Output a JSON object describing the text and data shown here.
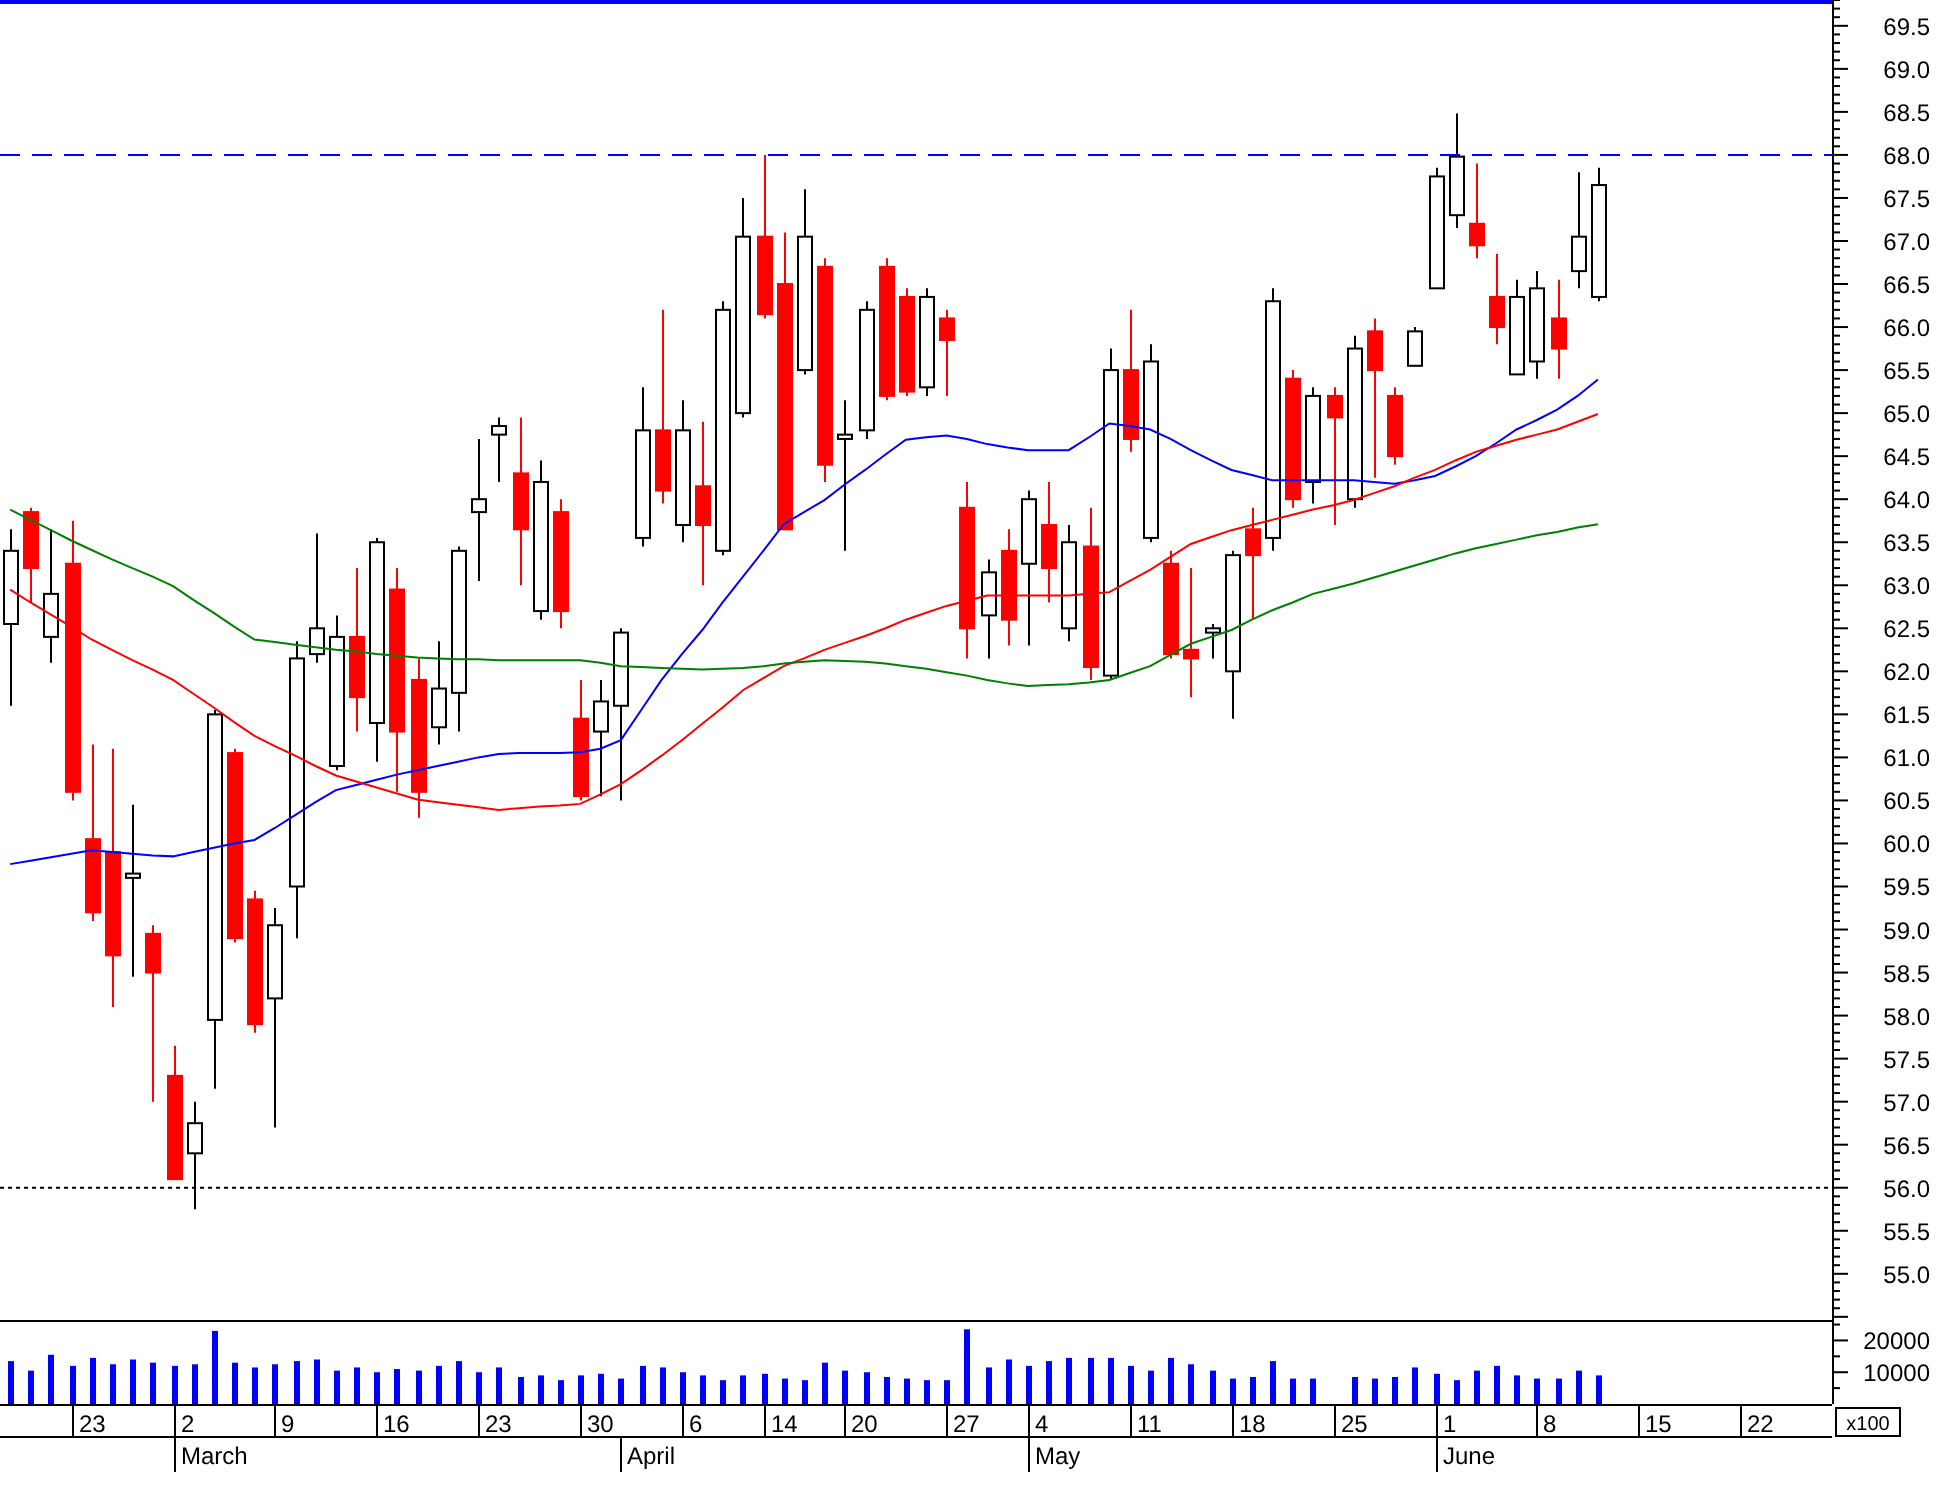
{
  "price_panel": {
    "chart_data": {
      "type": "candlestick",
      "ylim": [
        54.44,
        69.8
      ],
      "categories": [
        null,
        null,
        null,
        null,
        null,
        null,
        null,
        null,
        null,
        null,
        null,
        null,
        null,
        null,
        null,
        null,
        null,
        null,
        null,
        null,
        null,
        null,
        null,
        null,
        null,
        null,
        null,
        null,
        null,
        null,
        null,
        null,
        null,
        null,
        null,
        null,
        null,
        null,
        null,
        null,
        null,
        null,
        null,
        null,
        null,
        null,
        null,
        null,
        null,
        null,
        null,
        null,
        null,
        null,
        null,
        null,
        null,
        null,
        null,
        null,
        null,
        null,
        null,
        null,
        null,
        null,
        null,
        null,
        null,
        null,
        null,
        null,
        null,
        null,
        null,
        null,
        null,
        null,
        null,
        null,
        null,
        null,
        null,
        null,
        null,
        null,
        null,
        null,
        null,
        null
      ],
      "yticks": [
        {
          "value": 55,
          "label": "55.0"
        },
        {
          "value": 55.5,
          "label": "55.5"
        },
        {
          "value": 56,
          "label": "56.0"
        },
        {
          "value": 56.5,
          "label": "56.5"
        },
        {
          "value": 57,
          "label": "57.0"
        },
        {
          "value": 57.5,
          "label": "57.5"
        },
        {
          "value": 58,
          "label": "58.0"
        },
        {
          "value": 58.5,
          "label": "58.5"
        },
        {
          "value": 59,
          "label": "59.0"
        },
        {
          "value": 59.5,
          "label": "59.5"
        },
        {
          "value": 60,
          "label": "60.0"
        },
        {
          "value": 60.5,
          "label": "60.5"
        },
        {
          "value": 61,
          "label": "61.0"
        },
        {
          "value": 61.5,
          "label": "61.5"
        },
        {
          "value": 62,
          "label": "62.0"
        },
        {
          "value": 62.5,
          "label": "62.5"
        },
        {
          "value": 63,
          "label": "63.0"
        },
        {
          "value": 63.5,
          "label": "63.5"
        },
        {
          "value": 64,
          "label": "64.0"
        },
        {
          "value": 64.5,
          "label": "64.5"
        },
        {
          "value": 65,
          "label": "65.0"
        },
        {
          "value": 65.5,
          "label": "65.5"
        },
        {
          "value": 66,
          "label": "66.0"
        },
        {
          "value": 66.5,
          "label": "66.5"
        },
        {
          "value": 67,
          "label": "67.0"
        },
        {
          "value": 67.5,
          "label": "67.5"
        },
        {
          "value": 68,
          "label": "68.0"
        },
        {
          "value": 68.5,
          "label": "68.5"
        },
        {
          "value": 69,
          "label": "69.0"
        },
        {
          "value": 69.5,
          "label": "69.5"
        }
      ],
      "ohlc": [
        [
          62.55,
          63.65,
          61.6,
          63.4
        ],
        [
          63.85,
          63.9,
          62.8,
          63.2
        ],
        [
          62.4,
          63.65,
          62.1,
          62.9
        ],
        [
          63.25,
          63.75,
          60.5,
          60.6
        ],
        [
          60.05,
          61.15,
          59.1,
          59.2
        ],
        [
          59.9,
          61.1,
          58.1,
          58.7
        ],
        [
          59.6,
          60.45,
          58.45,
          59.65
        ],
        [
          58.95,
          59.05,
          57.0,
          58.5
        ],
        [
          57.3,
          57.65,
          56.1,
          56.1
        ],
        [
          56.4,
          57.0,
          55.75,
          56.75
        ],
        [
          57.95,
          61.55,
          57.15,
          61.5
        ],
        [
          61.05,
          61.1,
          58.85,
          58.9
        ],
        [
          59.35,
          59.45,
          57.8,
          57.9
        ],
        [
          58.2,
          59.25,
          56.7,
          59.05
        ],
        [
          59.5,
          62.35,
          58.9,
          62.15
        ],
        [
          62.2,
          63.6,
          62.1,
          62.5
        ],
        [
          60.9,
          62.65,
          60.85,
          62.4
        ],
        [
          62.4,
          63.2,
          61.3,
          61.7
        ],
        [
          61.4,
          63.55,
          60.95,
          63.5
        ],
        [
          62.95,
          63.2,
          60.6,
          61.3
        ],
        [
          61.9,
          62.15,
          60.3,
          60.6
        ],
        [
          61.35,
          62.35,
          61.15,
          61.8
        ],
        [
          61.75,
          63.45,
          61.3,
          63.4
        ],
        [
          63.85,
          64.7,
          63.05,
          64.0
        ],
        [
          64.75,
          64.95,
          64.2,
          64.85
        ],
        [
          64.3,
          64.95,
          63.0,
          63.65
        ],
        [
          62.7,
          64.45,
          62.6,
          64.2
        ],
        [
          63.85,
          64.0,
          62.5,
          62.7
        ],
        [
          61.45,
          61.9,
          60.5,
          60.55
        ],
        [
          61.3,
          61.9,
          60.55,
          61.65
        ],
        [
          61.6,
          62.5,
          60.5,
          62.45
        ],
        [
          63.55,
          65.3,
          63.45,
          64.8
        ],
        [
          64.8,
          66.2,
          63.95,
          64.1
        ],
        [
          63.7,
          65.15,
          63.5,
          64.8
        ],
        [
          64.15,
          64.9,
          63.0,
          63.7
        ],
        [
          63.4,
          66.3,
          63.35,
          66.2
        ],
        [
          65.0,
          67.5,
          64.95,
          67.05
        ],
        [
          67.05,
          68.0,
          66.1,
          66.15
        ],
        [
          66.5,
          67.1,
          63.65,
          63.65
        ],
        [
          65.5,
          67.6,
          65.45,
          67.05
        ],
        [
          66.7,
          66.8,
          64.2,
          64.4
        ],
        [
          64.7,
          65.15,
          63.4,
          64.75
        ],
        [
          64.8,
          66.3,
          64.7,
          66.2
        ],
        [
          66.7,
          66.8,
          65.15,
          65.2
        ],
        [
          66.35,
          66.45,
          65.2,
          65.25
        ],
        [
          65.3,
          66.45,
          65.2,
          66.35
        ],
        [
          66.1,
          66.2,
          65.2,
          65.85
        ],
        [
          63.9,
          64.2,
          62.15,
          62.5
        ],
        [
          62.65,
          63.3,
          62.15,
          63.15
        ],
        [
          63.4,
          63.65,
          62.3,
          62.6
        ],
        [
          63.25,
          64.1,
          62.3,
          64.0
        ],
        [
          63.7,
          64.2,
          62.8,
          63.2
        ],
        [
          62.5,
          63.7,
          62.35,
          63.5
        ],
        [
          63.45,
          63.9,
          61.9,
          62.05
        ],
        [
          61.95,
          65.75,
          61.9,
          65.5
        ],
        [
          65.5,
          66.2,
          64.55,
          64.7
        ],
        [
          63.55,
          65.8,
          63.5,
          65.6
        ],
        [
          63.25,
          63.4,
          62.15,
          62.2
        ],
        [
          62.25,
          63.2,
          61.7,
          62.15
        ],
        [
          62.45,
          62.55,
          62.15,
          62.5
        ],
        [
          62.0,
          63.4,
          61.45,
          63.35
        ],
        [
          63.65,
          63.9,
          62.6,
          63.35
        ],
        [
          63.55,
          66.45,
          63.4,
          66.3
        ],
        [
          65.4,
          65.5,
          63.9,
          64.0
        ],
        [
          64.2,
          65.3,
          63.95,
          65.2
        ],
        [
          65.2,
          65.3,
          63.7,
          64.95
        ],
        [
          64.0,
          65.9,
          63.9,
          65.75
        ],
        [
          65.95,
          66.1,
          64.25,
          65.5
        ],
        [
          65.2,
          65.3,
          64.4,
          64.5
        ],
        [
          65.55,
          66.0,
          65.55,
          65.95
        ],
        [
          66.45,
          67.85,
          66.45,
          67.75
        ],
        [
          67.3,
          68.48,
          67.15,
          67.98
        ],
        [
          67.2,
          67.9,
          66.8,
          66.95
        ],
        [
          66.35,
          66.85,
          65.8,
          66.0
        ],
        [
          65.45,
          66.55,
          65.45,
          66.35
        ],
        [
          65.6,
          66.65,
          65.4,
          66.45
        ],
        [
          66.1,
          66.55,
          65.4,
          65.75
        ],
        [
          66.65,
          67.8,
          66.45,
          67.05
        ],
        [
          66.35,
          67.85,
          66.3,
          67.65
        ],
        null,
        null,
        null,
        null,
        null,
        null,
        null,
        null,
        null,
        null,
        null
      ],
      "series": [
        {
          "type": "line",
          "color": "#0000ff",
          "values": [
            59.76,
            59.8,
            59.84,
            59.88,
            59.92,
            59.9,
            59.88,
            59.86,
            59.85,
            59.9,
            59.95,
            60.0,
            60.04,
            60.18,
            60.33,
            60.48,
            60.62,
            60.68,
            60.74,
            60.8,
            60.85,
            60.9,
            60.95,
            61.0,
            61.04,
            61.05,
            61.05,
            61.05,
            61.06,
            61.1,
            61.2,
            61.55,
            61.9,
            62.2,
            62.48,
            62.8,
            63.1,
            63.4,
            63.71,
            63.85,
            63.99,
            64.17,
            64.34,
            64.52,
            64.69,
            64.72,
            64.74,
            64.7,
            64.64,
            64.6,
            64.57,
            64.57,
            64.57,
            64.72,
            64.88,
            64.85,
            64.81,
            64.7,
            64.57,
            64.45,
            64.34,
            64.28,
            64.22,
            64.22,
            64.22,
            64.22,
            64.22,
            64.2,
            64.18,
            64.22,
            64.27,
            64.38,
            64.5,
            64.65,
            64.81,
            64.92,
            65.04,
            65.2,
            65.39,
            null,
            null,
            null,
            null,
            null,
            null,
            null,
            null,
            null,
            null,
            null
          ]
        },
        {
          "type": "line",
          "color": "#ff0000",
          "values": [
            62.95,
            62.8,
            62.66,
            62.52,
            62.37,
            62.25,
            62.13,
            62.02,
            61.9,
            61.74,
            61.58,
            61.41,
            61.25,
            61.13,
            61.02,
            60.9,
            60.79,
            60.72,
            60.65,
            60.58,
            60.51,
            60.48,
            60.45,
            60.42,
            60.39,
            60.41,
            60.43,
            60.44,
            60.46,
            60.57,
            60.69,
            60.85,
            61.02,
            61.2,
            61.39,
            61.58,
            61.78,
            61.92,
            62.06,
            62.15,
            62.25,
            62.33,
            62.41,
            62.5,
            62.6,
            62.68,
            62.76,
            62.82,
            62.88,
            62.88,
            62.88,
            62.88,
            62.88,
            62.9,
            62.92,
            63.05,
            63.18,
            63.33,
            63.48,
            63.56,
            63.64,
            63.7,
            63.76,
            63.82,
            63.88,
            63.93,
            63.99,
            64.07,
            64.15,
            64.25,
            64.34,
            64.45,
            64.55,
            64.62,
            64.69,
            64.75,
            64.81,
            64.9,
            64.99,
            null,
            null,
            null,
            null,
            null,
            null,
            null,
            null,
            null,
            null,
            null
          ]
        },
        {
          "type": "line",
          "color": "#008000",
          "values": [
            63.88,
            63.76,
            63.64,
            63.52,
            63.41,
            63.3,
            63.2,
            63.1,
            62.99,
            62.83,
            62.68,
            62.52,
            62.37,
            62.34,
            62.31,
            62.28,
            62.25,
            62.23,
            62.2,
            62.18,
            62.16,
            62.15,
            62.14,
            62.14,
            62.13,
            62.13,
            62.13,
            62.13,
            62.13,
            62.1,
            62.06,
            62.05,
            62.04,
            62.03,
            62.02,
            62.03,
            62.04,
            62.06,
            62.09,
            62.11,
            62.13,
            62.12,
            62.11,
            62.09,
            62.06,
            62.03,
            61.99,
            61.95,
            61.9,
            61.86,
            61.83,
            61.84,
            61.85,
            61.87,
            61.9,
            61.98,
            62.06,
            62.19,
            62.32,
            62.4,
            62.48,
            62.6,
            62.71,
            62.8,
            62.9,
            62.96,
            63.02,
            63.09,
            63.16,
            63.23,
            63.3,
            63.37,
            63.43,
            63.48,
            63.53,
            63.58,
            63.62,
            63.67,
            63.71,
            null,
            null,
            null,
            null,
            null,
            null,
            null,
            null,
            null,
            null,
            null
          ]
        }
      ],
      "ref_lines": [
        {
          "axis": "y",
          "value": 68,
          "color": "#0000ff"
        },
        {
          "axis": "y",
          "value": 56,
          "color": "#000000"
        }
      ]
    }
  },
  "volume_panel": {
    "unit_label": "x100",
    "chart_data": {
      "type": "bar",
      "ylim": [
        0,
        25800
      ],
      "categories": [
        null,
        null,
        null,
        null,
        "23",
        null,
        null,
        null,
        null,
        "2",
        null,
        null,
        null,
        null,
        "9",
        null,
        null,
        null,
        null,
        "16",
        null,
        null,
        null,
        null,
        "23",
        null,
        null,
        null,
        null,
        "30",
        null,
        null,
        null,
        null,
        "6",
        null,
        null,
        null,
        "14",
        null,
        null,
        null,
        "20",
        null,
        null,
        null,
        null,
        "27",
        null,
        null,
        null,
        "4",
        null,
        null,
        null,
        null,
        "11",
        null,
        null,
        null,
        null,
        "18",
        null,
        null,
        null,
        null,
        "25",
        null,
        null,
        null,
        null,
        "1",
        null,
        null,
        null,
        null,
        "8",
        null,
        null,
        null,
        null,
        "15",
        null,
        null,
        null,
        null,
        "22",
        null,
        null,
        null
      ],
      "yticks": [
        {
          "value": 10000,
          "label": "10000"
        },
        {
          "value": 20000,
          "label": "20000"
        }
      ],
      "values": [
        13500,
        10500,
        15500,
        12000,
        14500,
        12500,
        14000,
        13000,
        12000,
        12500,
        23000,
        13000,
        11500,
        12500,
        13500,
        14000,
        10500,
        11500,
        10000,
        11000,
        10500,
        12000,
        13500,
        10000,
        11500,
        8500,
        9000,
        7500,
        9000,
        9500,
        8000,
        12000,
        11500,
        10000,
        9000,
        7500,
        9000,
        9500,
        8000,
        7500,
        13000,
        10500,
        10000,
        8500,
        8000,
        7500,
        7500,
        23500,
        11500,
        14000,
        12000,
        13500,
        14500,
        14500,
        14500,
        12000,
        10500,
        14500,
        12500,
        10500,
        8000,
        8500,
        13500,
        8000,
        8000,
        null,
        8500,
        8000,
        8500,
        11500,
        9500,
        7500,
        10500,
        12000,
        9000,
        8000,
        8000,
        10500,
        9000,
        null,
        null,
        null,
        null,
        null,
        null,
        null,
        null,
        null,
        null,
        null
      ],
      "annotations": [
        "March",
        "April",
        "May",
        "June"
      ]
    }
  }
}
